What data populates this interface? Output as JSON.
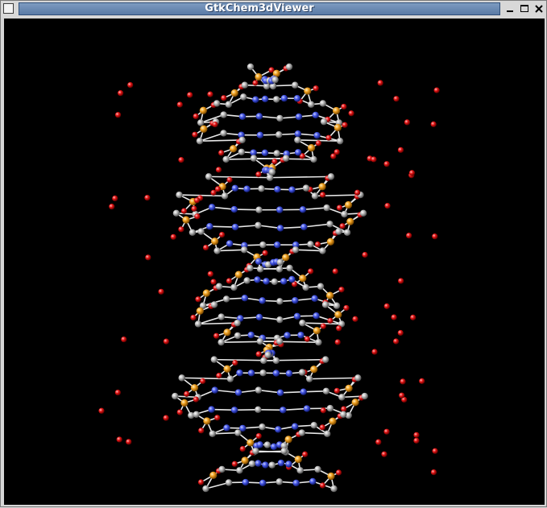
{
  "window": {
    "title": "GtkChem3dViewer"
  },
  "icons": {
    "menu": "window-menu-icon",
    "minimize": "minimize-icon",
    "maximize": "maximize-icon",
    "close": "close-icon"
  },
  "colors": {
    "background": "#000000",
    "carbon": "#a8a8a8",
    "nitrogen": "#3a4fe0",
    "oxygen": "#e01010",
    "phosphorus": "#f0a020",
    "bond": "#e8e8e8"
  }
}
